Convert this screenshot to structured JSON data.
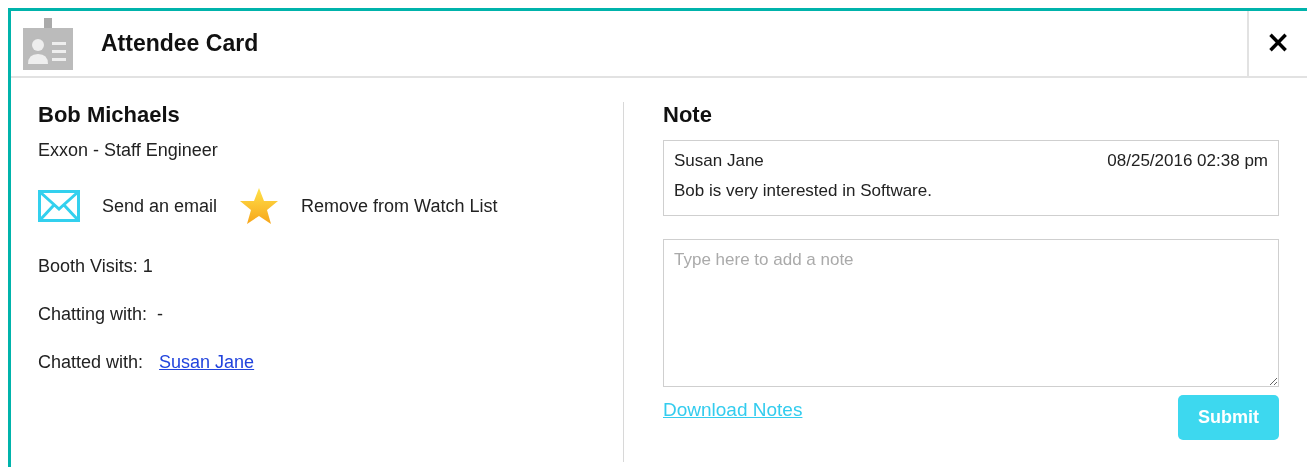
{
  "window": {
    "title": "Attendee Card",
    "close": "×"
  },
  "attendee": {
    "name": "Bob Michaels",
    "subtitle": "Exxon - Staff Engineer",
    "actions": [
      {
        "kind": "email",
        "label": "Send an email"
      },
      {
        "kind": "watch",
        "label": "Remove from Watch List"
      }
    ],
    "details": [
      {
        "kind": "plain",
        "label": "Booth Visits: 1"
      },
      {
        "kind": "plain",
        "label": "Chatting with:  -"
      },
      {
        "kind": "link",
        "label": "Chatted with:",
        "value": "Susan Jane"
      }
    ]
  },
  "notes": {
    "heading": "Note",
    "entries": [
      {
        "author": "Susan Jane",
        "time": "08/25/2016 02:38 pm",
        "text": "Bob is very interested in Software."
      }
    ],
    "input": {
      "placeholder": "Type here to add a note"
    },
    "download": "Download Notes",
    "submit": "Submit"
  }
}
